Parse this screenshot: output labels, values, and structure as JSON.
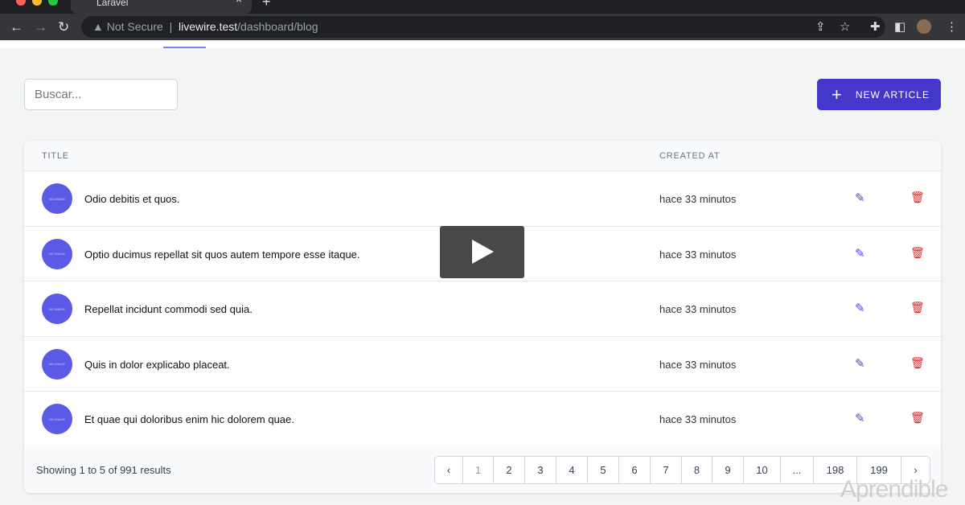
{
  "browser": {
    "tab_title": "Laravel",
    "security": "Not Secure",
    "url_host": "livewire.test",
    "url_path": "/dashboard/blog"
  },
  "search": {
    "placeholder": "Buscar..."
  },
  "new_article": {
    "label": "NEW ARTICLE"
  },
  "table": {
    "headers": {
      "title": "TITLE",
      "created_at": "CREATED AT"
    },
    "avatar_text": "NO IMAGE",
    "rows": [
      {
        "title": "Odio debitis et quos.",
        "created": "hace 33 minutos"
      },
      {
        "title": "Optio ducimus repellat sit quos autem tempore esse itaque.",
        "created": "hace 33 minutos"
      },
      {
        "title": "Repellat incidunt commodi sed quia.",
        "created": "hace 33 minutos"
      },
      {
        "title": "Quis in dolor explicabo placeat.",
        "created": "hace 33 minutos"
      },
      {
        "title": "Et quae qui doloribus enim hic dolorem quae.",
        "created": "hace 33 minutos"
      }
    ]
  },
  "pagination": {
    "summary": "Showing 1 to 5 of 991 results",
    "prev": "‹",
    "next": "›",
    "pages": [
      "1",
      "2",
      "3",
      "4",
      "5",
      "6",
      "7",
      "8",
      "9",
      "10",
      "...",
      "198",
      "199"
    ],
    "current": "1"
  },
  "watermark": "Aprendible"
}
